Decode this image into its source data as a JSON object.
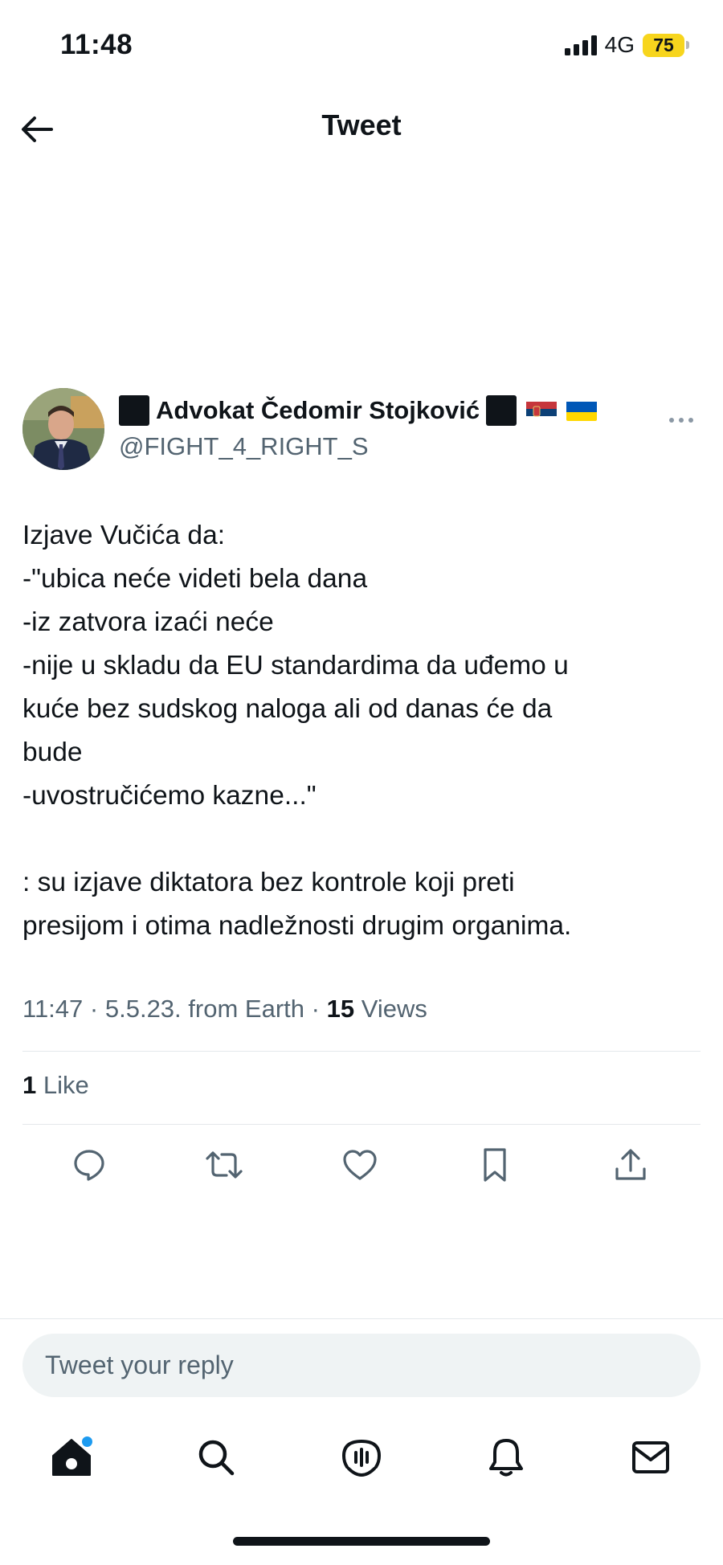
{
  "status_bar": {
    "time": "11:48",
    "network": "4G",
    "battery": "75",
    "battery_color": "#f7d51d"
  },
  "header": {
    "title": "Tweet",
    "back_icon": "arrow-left-icon"
  },
  "tweet": {
    "author": {
      "display_name": "Advokat Čedomir Stojković",
      "handle": "@FIGHT_4_RIGHT_S",
      "decorations": [
        "black-square",
        "black-square",
        "serbia-flag",
        "ukraine-flag"
      ]
    },
    "text_lines": [
      "Izjave Vučića da:",
      "-\"ubica neće videti bela dana",
      "-iz zatvora izaći neće",
      "-nije u skladu da EU standardima da uđemo u",
      "kuće bez sudskog naloga ali od danas će da",
      "bude",
      "-uvostručićemo kazne...\"",
      "",
      ": su izjave diktatora bez kontrole koji preti",
      "presijom i otima nadležnosti drugim organima."
    ],
    "meta": {
      "time": "11:47",
      "date": "5.5.23.",
      "source": "from Earth",
      "views_count": "15",
      "views_label": "Views",
      "separator": "·"
    },
    "likes": {
      "count": "1",
      "label": "Like"
    },
    "actions": [
      "reply-icon",
      "retweet-icon",
      "like-icon",
      "bookmark-icon",
      "share-icon"
    ]
  },
  "reply": {
    "placeholder": "Tweet your reply"
  },
  "bottom_nav": {
    "items": [
      "home-icon",
      "search-icon",
      "spaces-icon",
      "notifications-icon",
      "messages-icon"
    ],
    "accent_color": "#1d9bf0"
  },
  "colors": {
    "text": "#0f1419",
    "secondary": "#536471",
    "divider": "#e4e8eb"
  }
}
